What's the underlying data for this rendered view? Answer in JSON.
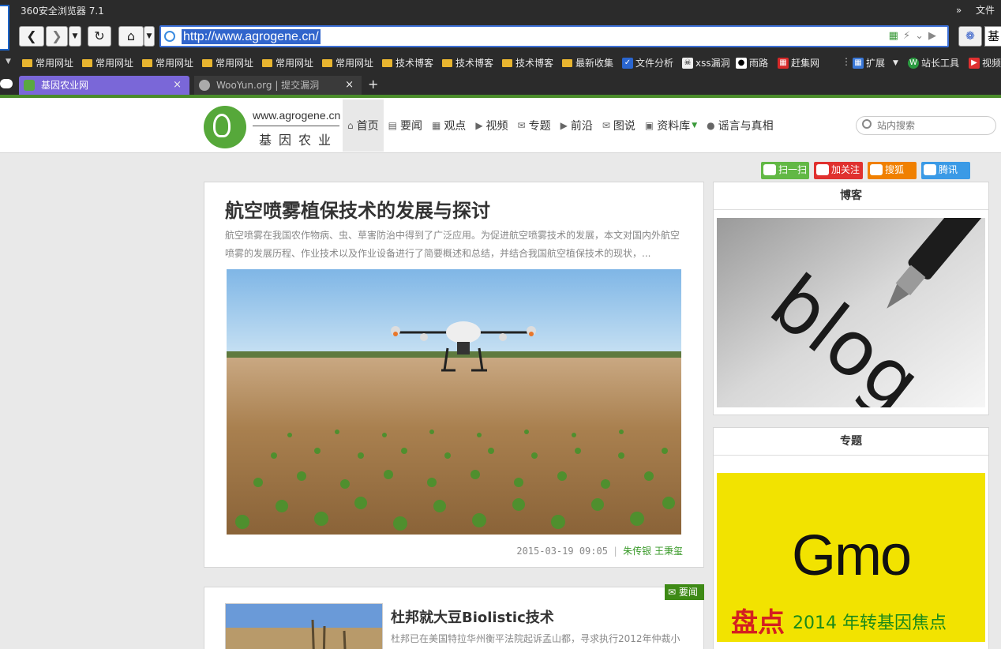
{
  "browser": {
    "title": "360安全浏览器 7.1",
    "menu_arrows": "»",
    "menu_file": "文件",
    "url": "http://www.agrogene.cn/",
    "search_stub": "基",
    "bookmarks": [
      {
        "label": "常用网址",
        "icon": "folder-icon"
      },
      {
        "label": "常用网址",
        "icon": "folder-icon"
      },
      {
        "label": "常用网址",
        "icon": "folder-icon"
      },
      {
        "label": "常用网址",
        "icon": "folder-icon"
      },
      {
        "label": "常用网址",
        "icon": "folder-icon"
      },
      {
        "label": "常用网址",
        "icon": "folder-icon"
      },
      {
        "label": "技术博客",
        "icon": "folder-icon"
      },
      {
        "label": "技术博客",
        "icon": "folder-icon"
      },
      {
        "label": "技术博客",
        "icon": "folder-icon"
      },
      {
        "label": "最新收集",
        "icon": "folder-icon"
      },
      {
        "label": "文件分析",
        "icon": "shield-icon"
      },
      {
        "label": "xss漏洞",
        "icon": "skull-icon"
      },
      {
        "label": "雨路",
        "icon": "penguin-icon"
      },
      {
        "label": "赶集网",
        "icon": "ganji-icon"
      },
      {
        "label": "扩展",
        "icon": "extensions-icon"
      },
      {
        "label": "站长工具",
        "icon": "webmaster-icon"
      },
      {
        "label": "视频",
        "icon": "video-icon"
      }
    ],
    "tabs": [
      {
        "label": "基因农业网",
        "close": "×"
      },
      {
        "label": "WooYun.org | 提交漏洞",
        "close": "×"
      }
    ],
    "new_tab": "+"
  },
  "site": {
    "logo_url": "www.agrogene.cn",
    "logo_name": "基因农业",
    "nav": [
      {
        "label": "首页",
        "icon": "home-icon",
        "active": true
      },
      {
        "label": "要闻",
        "icon": "news-icon"
      },
      {
        "label": "观点",
        "icon": "grid-icon"
      },
      {
        "label": "视频",
        "icon": "play-icon"
      },
      {
        "label": "专题",
        "icon": "comment-icon"
      },
      {
        "label": "前沿",
        "icon": "play-icon"
      },
      {
        "label": "图说",
        "icon": "comment-icon"
      },
      {
        "label": "资料库",
        "icon": "briefcase-icon",
        "dropdown": true
      },
      {
        "label": "谣言与真相",
        "icon": "users-icon"
      }
    ],
    "search_placeholder": "站内搜索",
    "share": [
      {
        "label": "扫一扫",
        "icon": "wechat-icon"
      },
      {
        "label": "加关注",
        "icon": "weibo-icon"
      },
      {
        "label": "搜狐",
        "icon": "sohu-icon"
      },
      {
        "label": "腾讯",
        "icon": "tencent-icon"
      }
    ]
  },
  "article1": {
    "title": "航空喷雾植保技术的发展与探讨",
    "summary": "航空喷雾在我国农作物病、虫、草害防治中得到了广泛应用。为促进航空喷雾技术的发展，本文对国内外航空喷雾的发展历程、作业技术以及作业设备进行了简要概述和总结，并结合我国航空植保技术的现状，...",
    "date": "2015-03-19 09:05",
    "sep": "|",
    "authors": "朱传银 王秉玺"
  },
  "article2": {
    "badge": "要闻",
    "title": "杜邦就大豆Biolistic技术",
    "summary": "杜邦已在美国特拉华州衡平法院起诉孟山都，寻求执行2012年仲裁小"
  },
  "sidebar": {
    "blog_title": "博客",
    "blog_image_text": "blog",
    "special_title": "专题",
    "special_image_main": "Gmo",
    "special_image_red": "盘点",
    "special_image_green": "2014 年转基因焦点"
  },
  "colors": {
    "accent_green": "#3e8a16",
    "tab_active": "#7a67d8",
    "address_highlight": "#3165cc"
  }
}
